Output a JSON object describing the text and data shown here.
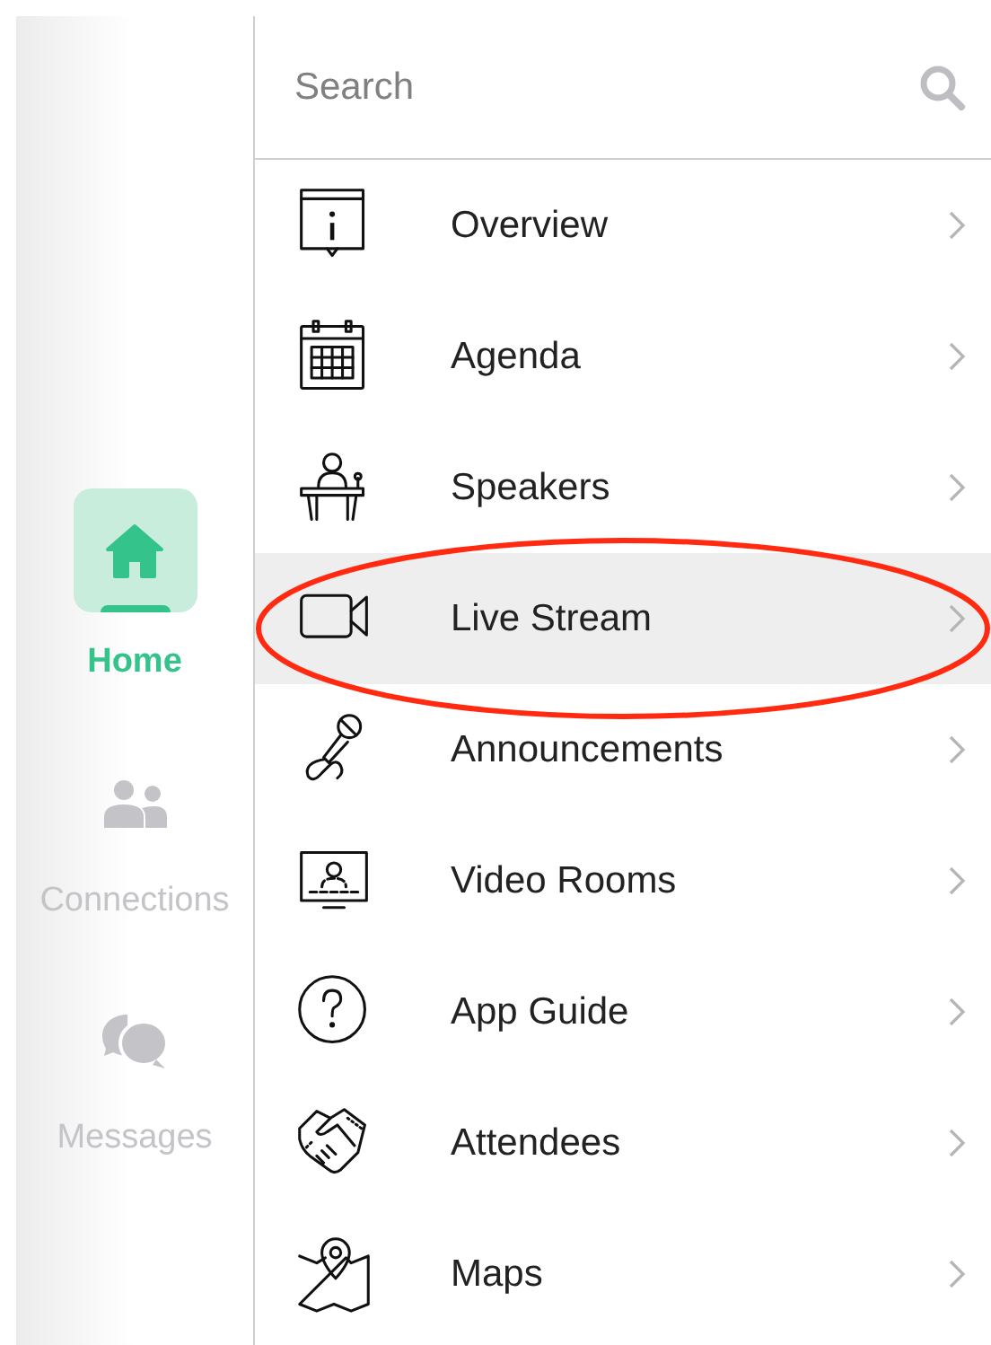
{
  "nav": [
    {
      "label": "Home",
      "selected": true
    },
    {
      "label": "Connections",
      "selected": false
    },
    {
      "label": "Messages",
      "selected": false
    }
  ],
  "search": {
    "placeholder": "Search"
  },
  "menu": [
    {
      "label": "Overview",
      "selected": false,
      "circled": false
    },
    {
      "label": "Agenda",
      "selected": false,
      "circled": false
    },
    {
      "label": "Speakers",
      "selected": false,
      "circled": false
    },
    {
      "label": "Live Stream",
      "selected": true,
      "circled": true
    },
    {
      "label": "Announcements",
      "selected": false,
      "circled": false
    },
    {
      "label": "Video Rooms",
      "selected": false,
      "circled": false
    },
    {
      "label": "App Guide",
      "selected": false,
      "circled": false
    },
    {
      "label": "Attendees",
      "selected": false,
      "circled": false
    },
    {
      "label": "Maps",
      "selected": false,
      "circled": false
    }
  ]
}
